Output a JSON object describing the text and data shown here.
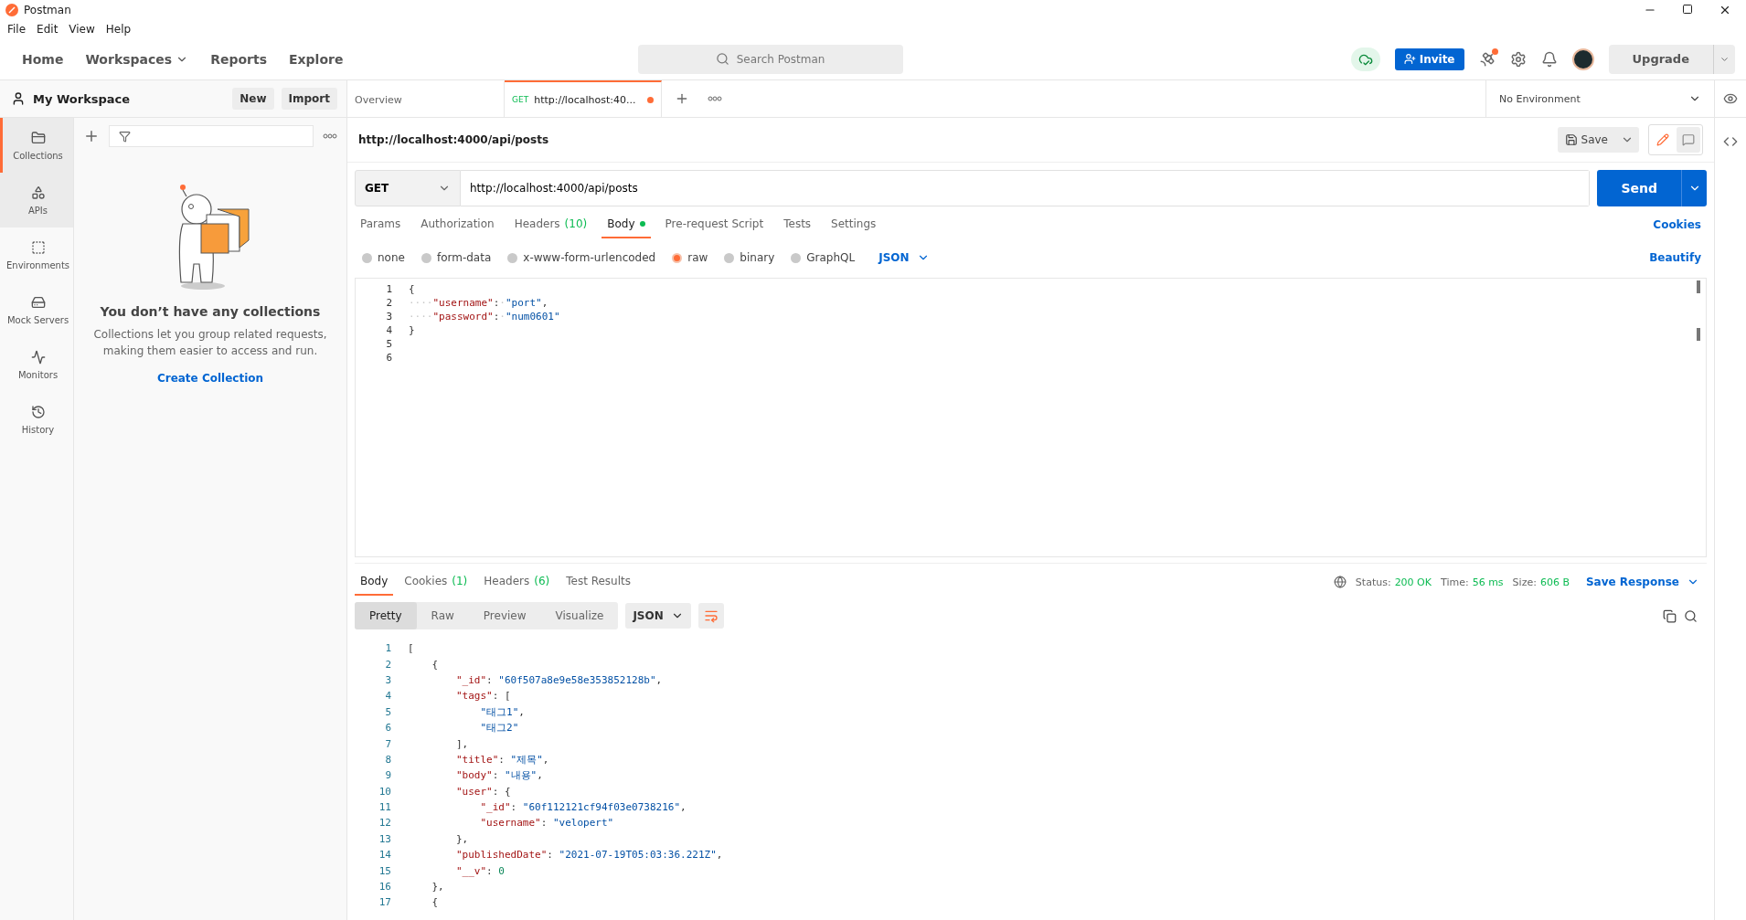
{
  "window": {
    "title": "Postman"
  },
  "menu": [
    "File",
    "Edit",
    "View",
    "Help"
  ],
  "nav": [
    {
      "label": "Home",
      "has_caret": false
    },
    {
      "label": "Workspaces",
      "has_caret": true
    },
    {
      "label": "Reports",
      "has_caret": false
    },
    {
      "label": "Explore",
      "has_caret": false
    }
  ],
  "search": {
    "placeholder": "Search Postman"
  },
  "header_buttons": {
    "invite": "Invite",
    "upgrade": "Upgrade"
  },
  "workspace": {
    "name": "My Workspace",
    "new": "New",
    "import": "Import"
  },
  "sidebar": {
    "items": [
      {
        "label": "Collections",
        "selected": true,
        "hovered": false
      },
      {
        "label": "APIs",
        "selected": false,
        "hovered": true
      },
      {
        "label": "Environments",
        "selected": false,
        "hovered": false
      },
      {
        "label": "Mock Servers",
        "selected": false,
        "hovered": false
      },
      {
        "label": "Monitors",
        "selected": false,
        "hovered": false
      },
      {
        "label": "History",
        "selected": false,
        "hovered": false
      }
    ]
  },
  "empty_state": {
    "title": "You don’t have any collections",
    "text": "Collections let you group related requests, making them easier to access and run.",
    "action": "Create Collection"
  },
  "tabs": [
    {
      "label": "Overview",
      "unsaved": false,
      "selected": false
    },
    {
      "label": "http://localhost:40...",
      "method": "GET",
      "unsaved": true,
      "selected": true
    }
  ],
  "environment": {
    "label": "No Environment"
  },
  "request": {
    "name": "http://localhost:4000/api/posts",
    "save": "Save",
    "method": "GET",
    "url": "http://localhost:4000/api/posts",
    "send": "Send",
    "tabs": [
      {
        "label": "Params",
        "dot": false,
        "selected": false
      },
      {
        "label": "Authorization",
        "dot": false,
        "selected": false
      },
      {
        "label": "Headers",
        "count": "(10)",
        "dot": false,
        "selected": false
      },
      {
        "label": "Body",
        "dot": true,
        "selected": true
      },
      {
        "label": "Pre-request Script",
        "dot": false,
        "selected": false
      },
      {
        "label": "Tests",
        "dot": false,
        "selected": false
      },
      {
        "label": "Settings",
        "dot": false,
        "selected": false
      }
    ],
    "cookies": "Cookies",
    "body_modes": [
      {
        "label": "none",
        "selected": false
      },
      {
        "label": "form-data",
        "selected": false
      },
      {
        "label": "x-www-form-urlencoded",
        "selected": false
      },
      {
        "label": "raw",
        "selected": true
      },
      {
        "label": "binary",
        "selected": false
      },
      {
        "label": "GraphQL",
        "selected": false
      }
    ],
    "format": "JSON",
    "beautify": "Beautify",
    "body_lines": [
      {
        "number": "1",
        "tokens": [
          {
            "kind": "punct",
            "text": "{"
          }
        ]
      },
      {
        "number": "2",
        "tokens": [
          {
            "kind": "ws",
            "text": "····"
          },
          {
            "kind": "key",
            "text": "\"username\""
          },
          {
            "kind": "punct",
            "text": ":"
          },
          {
            "kind": "ws",
            "text": "·"
          },
          {
            "kind": "string",
            "text": "\"port\""
          },
          {
            "kind": "punct",
            "text": ","
          }
        ]
      },
      {
        "number": "3",
        "tokens": [
          {
            "kind": "ws",
            "text": "····"
          },
          {
            "kind": "key",
            "text": "\"password\""
          },
          {
            "kind": "punct",
            "text": ":"
          },
          {
            "kind": "ws",
            "text": "·"
          },
          {
            "kind": "string",
            "text": "\"num0601\""
          }
        ]
      },
      {
        "number": "4",
        "tokens": [
          {
            "kind": "punct",
            "text": "}"
          }
        ]
      },
      {
        "number": "5"
      },
      {
        "number": "6"
      }
    ]
  },
  "response": {
    "tabs": [
      {
        "label": "Body",
        "selected": true
      },
      {
        "label": "Cookies",
        "count": "(1)",
        "selected": false
      },
      {
        "label": "Headers",
        "count": "(6)",
        "selected": false
      },
      {
        "label": "Test Results",
        "selected": false
      }
    ],
    "status": [
      {
        "label": "Status:",
        "value": "200 OK"
      },
      {
        "label": "Time:",
        "value": "56 ms"
      },
      {
        "label": "Size:",
        "value": "606 B"
      }
    ],
    "save": "Save Response",
    "views": [
      {
        "label": "Pretty",
        "selected": true
      },
      {
        "label": "Raw",
        "selected": false
      },
      {
        "label": "Preview",
        "selected": false
      },
      {
        "label": "Visualize",
        "selected": false
      }
    ],
    "format": "JSON",
    "lines": [
      {
        "number": "1",
        "tokens": [
          {
            "kind": "punct",
            "text": "["
          }
        ]
      },
      {
        "number": "2",
        "tokens": [
          {
            "kind": "punct",
            "text": "    {"
          }
        ]
      },
      {
        "number": "3",
        "tokens": [
          {
            "kind": "key",
            "text": "        \"_id\""
          },
          {
            "kind": "punct",
            "text": ": "
          },
          {
            "kind": "string",
            "text": "\"60f507a8e9e58e353852128b\""
          },
          {
            "kind": "punct",
            "text": ","
          }
        ]
      },
      {
        "number": "4",
        "tokens": [
          {
            "kind": "key",
            "text": "        \"tags\""
          },
          {
            "kind": "punct",
            "text": ": ["
          }
        ]
      },
      {
        "number": "5",
        "tokens": [
          {
            "kind": "string",
            "text": "            \"태그1\""
          },
          {
            "kind": "punct",
            "text": ","
          }
        ]
      },
      {
        "number": "6",
        "tokens": [
          {
            "kind": "string",
            "text": "            \"태그2\""
          }
        ]
      },
      {
        "number": "7",
        "tokens": [
          {
            "kind": "punct",
            "text": "        ],"
          }
        ]
      },
      {
        "number": "8",
        "tokens": [
          {
            "kind": "key",
            "text": "        \"title\""
          },
          {
            "kind": "punct",
            "text": ": "
          },
          {
            "kind": "string",
            "text": "\"제목\""
          },
          {
            "kind": "punct",
            "text": ","
          }
        ]
      },
      {
        "number": "9",
        "tokens": [
          {
            "kind": "key",
            "text": "        \"body\""
          },
          {
            "kind": "punct",
            "text": ": "
          },
          {
            "kind": "string",
            "text": "\"내용\""
          },
          {
            "kind": "punct",
            "text": ","
          }
        ]
      },
      {
        "number": "10",
        "tokens": [
          {
            "kind": "key",
            "text": "        \"user\""
          },
          {
            "kind": "punct",
            "text": ": {"
          }
        ]
      },
      {
        "number": "11",
        "tokens": [
          {
            "kind": "key",
            "text": "            \"_id\""
          },
          {
            "kind": "punct",
            "text": ": "
          },
          {
            "kind": "string",
            "text": "\"60f112121cf94f03e0738216\""
          },
          {
            "kind": "punct",
            "text": ","
          }
        ]
      },
      {
        "number": "12",
        "tokens": [
          {
            "kind": "key",
            "text": "            \"username\""
          },
          {
            "kind": "punct",
            "text": ": "
          },
          {
            "kind": "string",
            "text": "\"velopert\""
          }
        ]
      },
      {
        "number": "13",
        "tokens": [
          {
            "kind": "punct",
            "text": "        },"
          }
        ]
      },
      {
        "number": "14",
        "tokens": [
          {
            "kind": "key",
            "text": "        \"publishedDate\""
          },
          {
            "kind": "punct",
            "text": ": "
          },
          {
            "kind": "string",
            "text": "\"2021-07-19T05:03:36.221Z\""
          },
          {
            "kind": "punct",
            "text": ","
          }
        ]
      },
      {
        "number": "15",
        "tokens": [
          {
            "kind": "key",
            "text": "        \"__v\""
          },
          {
            "kind": "punct",
            "text": ": "
          },
          {
            "kind": "number",
            "text": "0"
          }
        ]
      },
      {
        "number": "16",
        "tokens": [
          {
            "kind": "punct",
            "text": "    },"
          }
        ]
      },
      {
        "number": "17",
        "tokens": [
          {
            "kind": "punct",
            "text": "    {"
          }
        ]
      }
    ]
  }
}
